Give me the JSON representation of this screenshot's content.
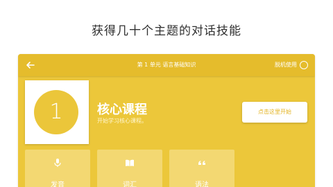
{
  "headline": "获得几十个主题的对话技能",
  "topbar": {
    "title": "第 1 单元 语言基础知识",
    "offline_label": "脱机使用"
  },
  "unit": {
    "number": "1",
    "course_title": "核心课程",
    "course_subtitle": "开始学习核心课程。"
  },
  "start_button": "点击这里开始",
  "tiles": [
    {
      "label": "发音",
      "icon": "microphone-icon"
    },
    {
      "label": "词汇",
      "icon": "book-icon"
    },
    {
      "label": "语法",
      "icon": "quote-icon"
    }
  ],
  "colors": {
    "app_background": "#ecc73a",
    "topbar": "#e5bc2c",
    "accent_text": "#e3b321",
    "tile": "#f3d872"
  }
}
